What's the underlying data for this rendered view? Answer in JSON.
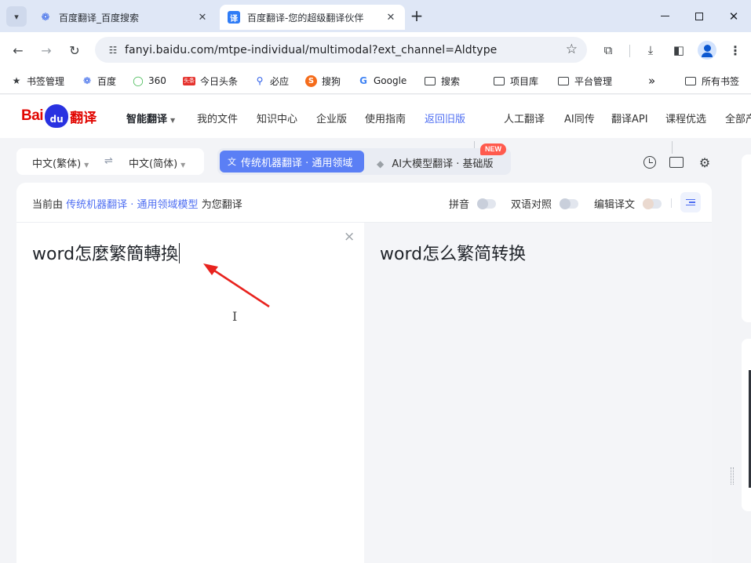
{
  "browser": {
    "tab_search_icon": "chevron-down-icon",
    "tabs": [
      {
        "title": "百度翻译_百度搜索",
        "favicon": "baidu-paw-icon",
        "active": false
      },
      {
        "title": "百度翻译-您的超级翻译伙伴",
        "favicon_text": "译",
        "active": true
      }
    ],
    "new_tab_label": "+",
    "url": "fanyi.baidu.com/mtpe-individual/multimodal?ext_channel=Aldtype",
    "bookmarks": [
      {
        "label": "书签管理",
        "icon": "star-icon"
      },
      {
        "label": "百度",
        "icon": "baidu-paw-icon"
      },
      {
        "label": "360",
        "icon": "360-icon"
      },
      {
        "label": "今日头条",
        "icon": "toutiao-icon",
        "icon_text": "头条"
      },
      {
        "label": "必应",
        "icon": "search-icon"
      },
      {
        "label": "搜狗",
        "icon": "sogou-icon",
        "icon_text": "S"
      },
      {
        "label": "Google",
        "icon": "google-icon",
        "icon_text": "G"
      },
      {
        "label": "搜索",
        "icon": "folder-icon"
      },
      {
        "label": "项目库",
        "icon": "folder-icon"
      },
      {
        "label": "平台管理",
        "icon": "folder-icon"
      },
      {
        "label": "所有书签",
        "icon": "folder-icon"
      }
    ],
    "overflow_label": "»"
  },
  "header": {
    "logo": {
      "bai": "Bai",
      "du": "du",
      "fanyi": "翻译"
    },
    "nav": [
      "智能翻译",
      "我的文件",
      "知识中心",
      "企业版",
      "使用指南",
      "返回旧版"
    ],
    "nav_right": [
      "人工翻译",
      "AI同传",
      "翻译API",
      "课程优选",
      "全部产"
    ]
  },
  "toolbar": {
    "source_lang": "中文(繁体)",
    "target_lang": "中文(简体)",
    "swap_icon": "⇌",
    "mode_active": "传统机器翻译 · 通用领域",
    "mode_alt": "AI大模型翻译 · 基础版",
    "new_badge": "NEW"
  },
  "card": {
    "engine_prefix": "当前由",
    "engine_link": "传统机器翻译 · 通用领域模型",
    "engine_suffix": "为您翻译",
    "options": [
      {
        "label": "拼音",
        "on": false
      },
      {
        "label": "双语对照",
        "on": false
      },
      {
        "label": "编辑译文",
        "on": false
      }
    ],
    "source_text": "word怎麼繁簡轉換",
    "target_text": "word怎么繁简转换",
    "clear_icon": "×"
  },
  "colors": {
    "accent": "#4e6ef2",
    "mode_active_bg": "#5b7ff5",
    "baidu_red": "#e10601",
    "baidu_blue": "#2932e1",
    "new_badge": "#ff5a4d",
    "annotation_arrow": "#e8231e"
  }
}
